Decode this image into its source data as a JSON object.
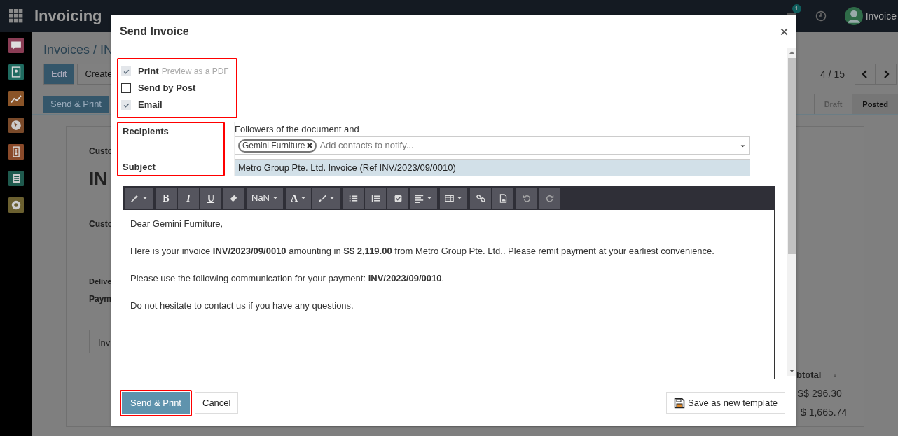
{
  "topbar": {
    "brand": "Invoicing",
    "chat_badge": "1",
    "user": "Invoice"
  },
  "sidebar": {
    "apps": [
      {
        "kind": "chat",
        "color": "#8a3d55"
      },
      {
        "kind": "contacts",
        "color": "#1f6b60"
      },
      {
        "kind": "chart",
        "color": "#8a5428"
      },
      {
        "kind": "globe",
        "color": "#7a4a2a"
      },
      {
        "kind": "invoice",
        "color": "#8a4a2a"
      },
      {
        "kind": "document",
        "color": "#1f5a4e"
      },
      {
        "kind": "settings",
        "color": "#6b6030"
      }
    ]
  },
  "page": {
    "breadcrumb": "Invoices / IN",
    "buttons": [
      "Edit",
      "Create"
    ],
    "pager": "4 / 15",
    "action_button": "Send & Print",
    "stages": [
      {
        "label": "Draft",
        "selected": false
      },
      {
        "label": "Posted",
        "selected": true
      }
    ],
    "sheet": {
      "labels": [
        "Custo",
        "IN",
        "Custo",
        "Delive",
        "Paym"
      ],
      "tab": "Inv",
      "column": "btotal",
      "amounts": [
        "S$ 296.30",
        "$ 1,665.74"
      ]
    }
  },
  "dialog": {
    "title": "Send Invoice",
    "options": [
      {
        "label": "Print",
        "hint": "Preview as a PDF",
        "checked": true
      },
      {
        "label": "Send by Post",
        "checked": false
      },
      {
        "label": "Email",
        "checked": true
      }
    ],
    "recipients": {
      "label": "Recipients",
      "intro": "Followers of the document and",
      "tags": [
        "Gemini Furniture"
      ],
      "placeholder": "Add contacts to notify..."
    },
    "subject": {
      "label": "Subject",
      "value": "Metro Group Pte. Ltd. Invoice (Ref INV/2023/09/0010)"
    },
    "toolbar": [
      [
        {
          "kind": "wand",
          "caret": true
        }
      ],
      [
        {
          "kind": "bold",
          "label": "B"
        },
        {
          "kind": "italic",
          "label": "I"
        },
        {
          "kind": "underline",
          "label": "U"
        },
        {
          "kind": "eraser"
        }
      ],
      [
        {
          "kind": "font-size",
          "label": "NaN",
          "caret": true
        }
      ],
      [
        {
          "kind": "font-color",
          "label": "A",
          "caret": true
        },
        {
          "kind": "brush",
          "caret": true
        }
      ],
      [
        {
          "kind": "list"
        },
        {
          "kind": "numbered-list"
        },
        {
          "kind": "checklist"
        },
        {
          "kind": "align",
          "caret": true
        }
      ],
      [
        {
          "kind": "table",
          "caret": true
        }
      ],
      [
        {
          "kind": "link"
        },
        {
          "kind": "image"
        }
      ],
      [
        {
          "kind": "undo"
        },
        {
          "kind": "redo"
        }
      ]
    ],
    "body": [
      "Dear Gemini Furniture,",
      "Here is your invoice **INV/2023/09/0010** amounting in **S$ 2,119.00** from Metro Group Pte. Ltd.. Please remit payment at your earliest convenience.",
      "Please use the following communication for your payment: **INV/2023/09/0010**.",
      "Do not hesitate to contact us if you have any questions."
    ],
    "footer": {
      "send": "Send & Print",
      "cancel": "Cancel",
      "save_template": "Save as new template"
    }
  }
}
